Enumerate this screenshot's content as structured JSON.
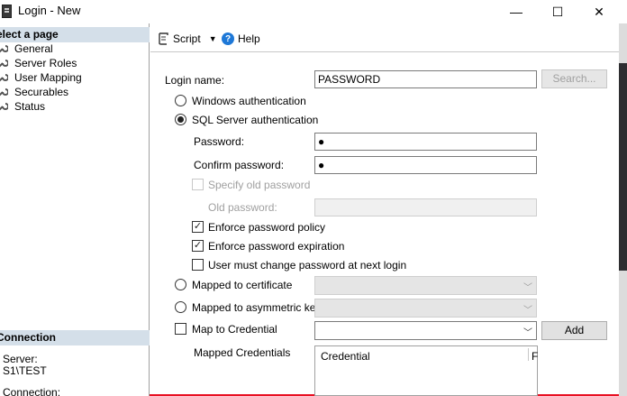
{
  "window": {
    "title": "Login - New",
    "minimize_glyph": "—",
    "maximize_glyph": "☐",
    "close_glyph": "✕"
  },
  "sidebar": {
    "select_page_label": "elect a page",
    "items": [
      {
        "label": "General",
        "icon": "wrench-icon"
      },
      {
        "label": "Server Roles",
        "icon": "wrench-icon"
      },
      {
        "label": "User Mapping",
        "icon": "wrench-icon"
      },
      {
        "label": "Securables",
        "icon": "wrench-icon"
      },
      {
        "label": "Status",
        "icon": "wrench-icon"
      }
    ],
    "connection_label": "Connection",
    "server_label": "Server:",
    "server_value": "S1\\TEST",
    "connection_field_label": "Connection:"
  },
  "toolbar": {
    "script_label": "Script",
    "help_label": "Help"
  },
  "form": {
    "login_name_label": "Login name:",
    "login_name_value": "PASSWORD",
    "search_label": "Search...",
    "windows_auth_label": "Windows authentication",
    "sql_auth_label": "SQL Server authentication",
    "password_label": "Password:",
    "password_value": "●",
    "confirm_password_label": "Confirm password:",
    "confirm_password_value": "●",
    "specify_old_label": "Specify old password",
    "old_password_label": "Old password:",
    "enforce_policy_label": "Enforce password policy",
    "enforce_expiration_label": "Enforce password expiration",
    "must_change_label": "User must change password at next login",
    "mapped_cert_label": "Mapped to certificate",
    "mapped_asym_label": "Mapped to asymmetric key",
    "map_credential_label": "Map to Credential",
    "add_label": "Add",
    "mapped_credentials_label": "Mapped Credentials",
    "grid_col_credential": "Credential",
    "grid_col_provider": "F",
    "check_glyph": "✓"
  },
  "colors": {
    "frame_border": "#e81123",
    "section_header_bg": "#d4dfe9",
    "help_icon": "#1e78d7"
  }
}
